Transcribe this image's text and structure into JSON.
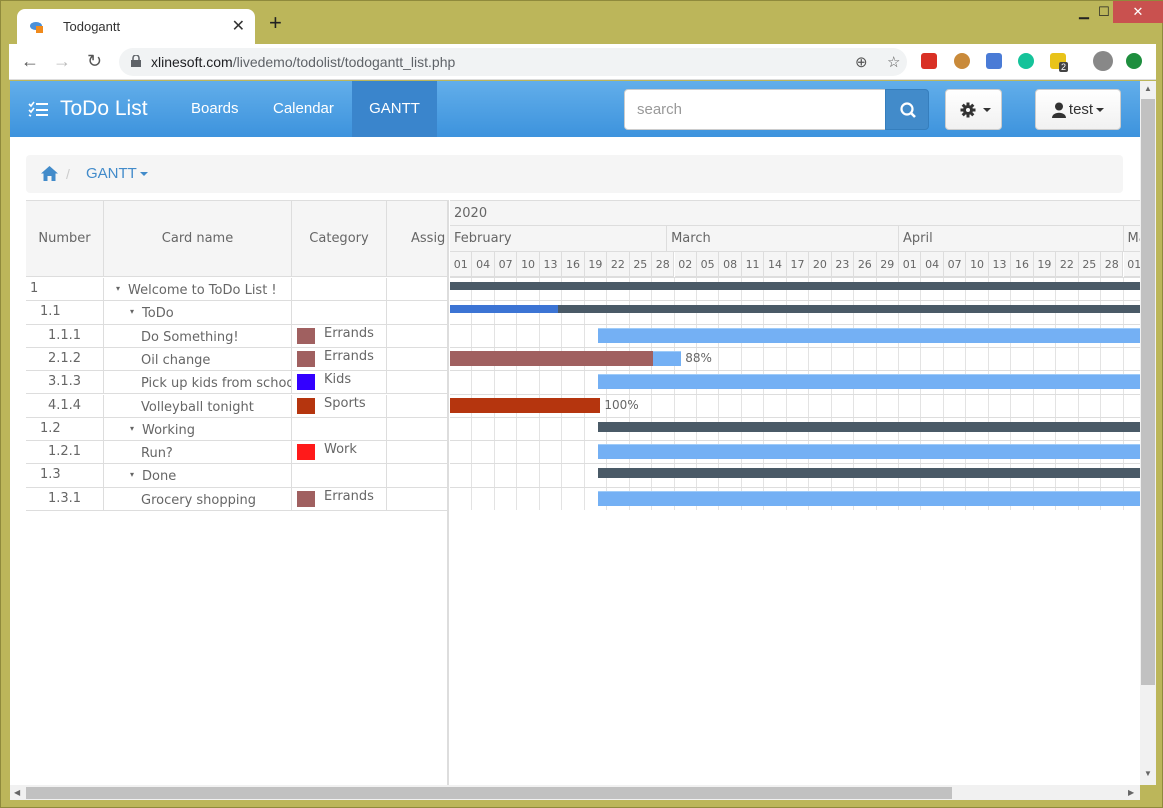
{
  "browser": {
    "tab_title": "Todogantt",
    "url_host": "xlinesoft.com",
    "url_path": "/livedemo/todolist/todogantt_list.php",
    "extensions": [
      {
        "name": "book-extension",
        "color": "#d93025"
      },
      {
        "name": "cookie-extension",
        "color": "#c98a3a"
      },
      {
        "name": "ruler-extension",
        "color": "#4a7bd6"
      },
      {
        "name": "grammarly-extension",
        "color": "#15c39a"
      },
      {
        "name": "notes-extension",
        "color": "#e8c31a",
        "badge": "2"
      },
      {
        "name": "profile-avatar",
        "color": "#888888"
      },
      {
        "name": "update-extension",
        "color": "#1e8e3e"
      }
    ]
  },
  "navbar": {
    "brand": "ToDo List",
    "links": [
      {
        "label": "Boards",
        "active": false
      },
      {
        "label": "Calendar",
        "active": false
      },
      {
        "label": "GANTT",
        "active": true
      }
    ],
    "search_placeholder": "search",
    "user_label": "test"
  },
  "breadcrumb": {
    "current": "GANTT"
  },
  "grid": {
    "columns": [
      "Number",
      "Card name",
      "Category",
      "Assig"
    ],
    "rows": [
      {
        "number": "1",
        "name": "Welcome to ToDo List !",
        "level": 0,
        "group": true,
        "category": "",
        "cat_color": ""
      },
      {
        "number": "1.1",
        "name": "ToDo",
        "level": 1,
        "group": true,
        "category": "",
        "cat_color": ""
      },
      {
        "number": "1.1.1",
        "name": "Do Something!",
        "level": 2,
        "group": false,
        "category": "Errands",
        "cat_color": "#a06060"
      },
      {
        "number": "2.1.2",
        "name": "Oil change",
        "level": 2,
        "group": false,
        "category": "Errands",
        "cat_color": "#a06060"
      },
      {
        "number": "3.1.3",
        "name": "Pick up kids from school",
        "level": 2,
        "group": false,
        "category": "Kids",
        "cat_color": "#3300ff"
      },
      {
        "number": "4.1.4",
        "name": "Volleyball tonight",
        "level": 2,
        "group": false,
        "category": "Sports",
        "cat_color": "#b5350e"
      },
      {
        "number": "1.2",
        "name": "Working",
        "level": 1,
        "group": true,
        "category": "",
        "cat_color": ""
      },
      {
        "number": "1.2.1",
        "name": "Run?",
        "level": 2,
        "group": false,
        "category": "Work",
        "cat_color": "#ff1a1a"
      },
      {
        "number": "1.3",
        "name": "Done",
        "level": 1,
        "group": true,
        "category": "",
        "cat_color": ""
      },
      {
        "number": "1.3.1",
        "name": "Grocery shopping",
        "level": 2,
        "group": false,
        "category": "Errands",
        "cat_color": "#a06060"
      }
    ]
  },
  "gantt": {
    "year": "2020",
    "months": [
      {
        "label": "February",
        "start_idx": 0,
        "end_idx": 9.67
      },
      {
        "label": "March",
        "start_idx": 9.67,
        "end_idx": 20
      },
      {
        "label": "April",
        "start_idx": 20,
        "end_idx": 30
      },
      {
        "label": "May",
        "start_idx": 30,
        "end_idx": 31
      }
    ],
    "days": [
      "01",
      "04",
      "07",
      "10",
      "13",
      "16",
      "19",
      "22",
      "25",
      "28",
      "02",
      "05",
      "08",
      "11",
      "14",
      "17",
      "20",
      "23",
      "26",
      "29",
      "01",
      "04",
      "07",
      "10",
      "13",
      "16",
      "19",
      "22",
      "25",
      "28",
      "01"
    ],
    "colors": {
      "summary": "#4a5a67",
      "summary_progress": "#3c74d4",
      "task": "#74b0f4"
    },
    "bars": [
      {
        "row": 0,
        "type": "summary",
        "start": 0,
        "end": 31,
        "progress": 0
      },
      {
        "row": 1,
        "type": "summary",
        "start": 0,
        "end": 31,
        "progress": 0.155
      },
      {
        "row": 2,
        "type": "task",
        "start": 6.6,
        "end": 31,
        "progress": 0,
        "progress_color": ""
      },
      {
        "row": 3,
        "type": "task",
        "start": 0,
        "end": 10.3,
        "progress": 0.88,
        "progress_color": "#a06060",
        "label": "88%"
      },
      {
        "row": 4,
        "type": "task",
        "start": 6.6,
        "end": 31,
        "progress": 0,
        "progress_color": ""
      },
      {
        "row": 5,
        "type": "task",
        "start": 0,
        "end": 6.7,
        "progress": 1.0,
        "progress_color": "#b5350e",
        "label": "100%"
      },
      {
        "row": 6,
        "type": "summary",
        "start": 6.6,
        "end": 31,
        "progress": 0
      },
      {
        "row": 7,
        "type": "task",
        "start": 6.6,
        "end": 31,
        "progress": 0,
        "progress_color": ""
      },
      {
        "row": 8,
        "type": "summary",
        "start": 6.6,
        "end": 31,
        "progress": 0
      },
      {
        "row": 9,
        "type": "task",
        "start": 6.6,
        "end": 31,
        "progress": 0,
        "progress_color": ""
      }
    ]
  }
}
